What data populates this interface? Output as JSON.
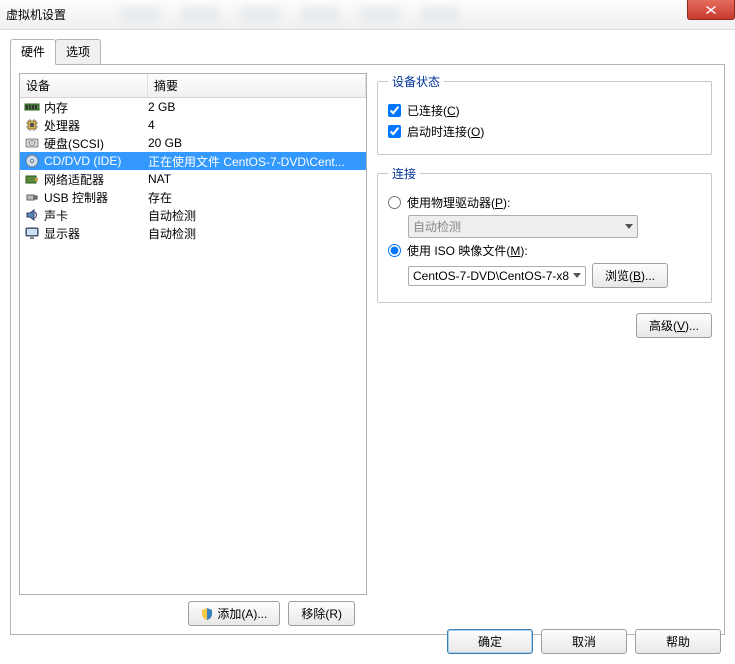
{
  "window": {
    "title": "虚拟机设置"
  },
  "tabs": {
    "hardware": "硬件",
    "options": "选项"
  },
  "list": {
    "header_device": "设备",
    "header_summary": "摘要",
    "items": [
      {
        "icon": "memory",
        "name": "内存",
        "summary": "2 GB"
      },
      {
        "icon": "cpu",
        "name": "处理器",
        "summary": "4"
      },
      {
        "icon": "disk",
        "name": "硬盘(SCSI)",
        "summary": "20 GB"
      },
      {
        "icon": "cd",
        "name": "CD/DVD (IDE)",
        "summary": "正在使用文件 CentOS-7-DVD\\Cent..."
      },
      {
        "icon": "nic",
        "name": "网络适配器",
        "summary": "NAT"
      },
      {
        "icon": "usb",
        "name": "USB 控制器",
        "summary": "存在"
      },
      {
        "icon": "sound",
        "name": "声卡",
        "summary": "自动检测"
      },
      {
        "icon": "display",
        "name": "显示器",
        "summary": "自动检测"
      }
    ],
    "selected_index": 3,
    "add_button": "添加(A)...",
    "remove_button": "移除(R)"
  },
  "device_status": {
    "legend": "设备状态",
    "connected_label": "已连接(C)",
    "connected_checked": true,
    "connect_at_poweron_label": "启动时连接(O)",
    "connect_at_poweron_checked": true
  },
  "connection": {
    "legend": "连接",
    "use_physical_label": "使用物理驱动器(P):",
    "physical_auto": "自动检测",
    "use_iso_label": "使用 ISO 映像文件(M):",
    "iso_path": "CentOS-7-DVD\\CentOS-7-x8",
    "browse_button": "浏览(B)...",
    "selected": "iso"
  },
  "advanced_button": "高级(V)...",
  "bottom": {
    "ok": "确定",
    "cancel": "取消",
    "help": "帮助"
  }
}
